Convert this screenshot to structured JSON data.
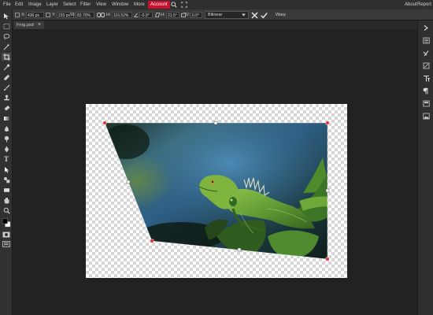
{
  "menu": {
    "left": [
      "File",
      "Edit",
      "Image",
      "Layer",
      "Select",
      "Filter",
      "View",
      "Window",
      "More"
    ],
    "account": "Account",
    "right": [
      "About",
      "Report"
    ]
  },
  "options": {
    "x_label": "X:",
    "x_value": "436 px",
    "y_label": "Y:",
    "y_value": "233 px",
    "w_label": "W:",
    "w_value": "83.70%",
    "h_label": "H:",
    "h_value": "116.52%",
    "angle_value": "-0.9°",
    "skew_h_label": "H:",
    "skew_h_value": "21.5°",
    "skew_v_label": "V:",
    "skew_v_value": "0.0°",
    "interpolation": "Bilinear",
    "warp_label": "Warp"
  },
  "tab": {
    "name": "Frog.psd",
    "close": "×"
  },
  "colors": {
    "accent": "#c8102e",
    "handle_corner": "#dd2222",
    "bg": "#222222"
  }
}
